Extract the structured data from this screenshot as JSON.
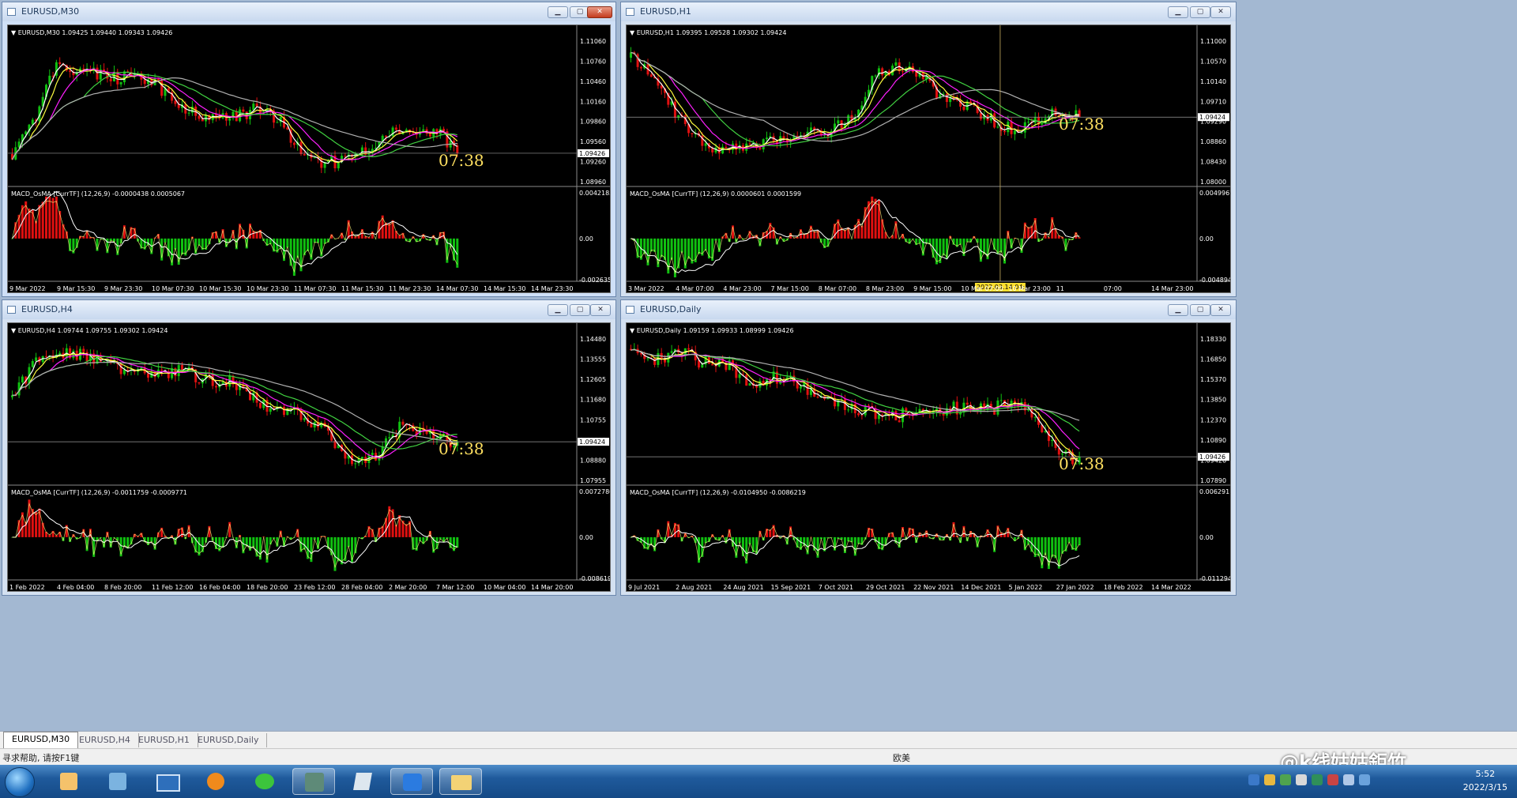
{
  "windows": [
    {
      "title": "EURUSD,M30",
      "ohlc_line": "EURUSD,M30  1.09425 1.09440 1.09343 1.09426",
      "macd_line": "MACD_OsMA [CurrTF] (12,26,9) -0.0000438 0.0005067",
      "price_labels": [
        "1.11060",
        "1.10760",
        "1.10460",
        "1.10160",
        "1.09860",
        "1.09560",
        "1.09260",
        "1.08960"
      ],
      "current_price": "1.09426",
      "macd_labels": [
        "0.0042185",
        "0.00",
        "-0.002635"
      ],
      "time_labels": [
        "9 Mar 2022",
        "9 Mar 15:30",
        "9 Mar 23:30",
        "10 Mar 07:30",
        "10 Mar 15:30",
        "10 Mar 23:30",
        "11 Mar 07:30",
        "11 Mar 15:30",
        "11 Mar 23:30",
        "14 Mar 07:30",
        "14 Mar 15:30",
        "14 Mar 23:30"
      ],
      "countdown": "07:38",
      "close_color": "#c8321e"
    },
    {
      "title": "EURUSD,H1",
      "ohlc_line": "EURUSD,H1  1.09395 1.09528 1.09302 1.09424",
      "macd_line": "MACD_OsMA [CurrTF] (12,26,9) 0.0000601 0.0001599",
      "price_labels": [
        "1.11000",
        "1.10570",
        "1.10140",
        "1.09710",
        "1.09290",
        "1.08860",
        "1.08430",
        "1.08000"
      ],
      "current_price": "1.09424",
      "macd_labels": [
        "0.0049967",
        "0.00",
        "-0.004894"
      ],
      "time_labels": [
        "3 Mar 2022",
        "4 Mar 07:00",
        "4 Mar 23:00",
        "7 Mar 15:00",
        "8 Mar 07:00",
        "8 Mar 23:00",
        "9 Mar 15:00",
        "10 Mar 07:00",
        "10 Mar 23:00",
        "11",
        "07:00",
        "14 Mar 23:00"
      ],
      "crosshair_time": "2022.03.14 04:15",
      "countdown": "07:38"
    },
    {
      "title": "EURUSD,H4",
      "ohlc_line": "EURUSD,H4  1.09744 1.09755 1.09302 1.09424",
      "macd_line": "MACD_OsMA [CurrTF] (12,26,9) -0.0011759 -0.0009771",
      "price_labels": [
        "1.14480",
        "1.13555",
        "1.12605",
        "1.11680",
        "1.10755",
        "1.09805",
        "1.08880",
        "1.07955"
      ],
      "current_price": "1.09424",
      "macd_labels": [
        "0.0072786",
        "0.00",
        "-0.008619"
      ],
      "time_labels": [
        "1 Feb 2022",
        "4 Feb 04:00",
        "8 Feb 20:00",
        "11 Feb 12:00",
        "16 Feb 04:00",
        "18 Feb 20:00",
        "23 Feb 12:00",
        "28 Feb 04:00",
        "2 Mar 20:00",
        "7 Mar 12:00",
        "10 Mar 04:00",
        "14 Mar 20:00"
      ],
      "countdown": "07:38"
    },
    {
      "title": "EURUSD,Daily",
      "ohlc_line": "EURUSD,Daily  1.09159 1.09933 1.08999 1.09426",
      "macd_line": "MACD_OsMA [CurrTF] (12,26,9) -0.0104950 -0.0086219",
      "price_labels": [
        "1.18330",
        "1.16850",
        "1.15370",
        "1.13850",
        "1.12370",
        "1.10890",
        "1.09426",
        "1.07890"
      ],
      "current_price": "1.09426",
      "macd_labels": [
        "0.0062911",
        "0.00",
        "-0.011294"
      ],
      "time_labels": [
        "9 Jul 2021",
        "2 Aug 2021",
        "24 Aug 2021",
        "15 Sep 2021",
        "7 Oct 2021",
        "29 Oct 2021",
        "22 Nov 2021",
        "14 Dec 2021",
        "5 Jan 2022",
        "27 Jan 2022",
        "18 Feb 2022",
        "14 Mar 2022"
      ],
      "countdown": "07:38"
    }
  ],
  "tabs": [
    "EURUSD,M30",
    "EURUSD,H4",
    "EURUSD,H1",
    "EURUSD,Daily"
  ],
  "status": {
    "help": "寻求帮助, 请按F1键",
    "profile": "欧美"
  },
  "clock": {
    "time": "5:52",
    "date": "2022/3/15"
  },
  "watermark": "@k线姑姑鉅竹",
  "colors": {
    "bull": "#10c010",
    "bear": "#e01010",
    "ma_fast": "#ffffff",
    "ma_yellow": "#ffff40",
    "ma_magenta": "#ff20ff",
    "ma_green": "#40d040",
    "ma_gray": "#b0b0b0",
    "countdown": "#ffe060"
  },
  "taskbar_icons": [
    "start-orb-icon",
    "mt4-icon",
    "contacts-icon",
    "desktop-icon",
    "browser-icon",
    "wechat-icon",
    "app-icon",
    "pen-icon",
    "notes-icon",
    "folder-icon"
  ]
}
